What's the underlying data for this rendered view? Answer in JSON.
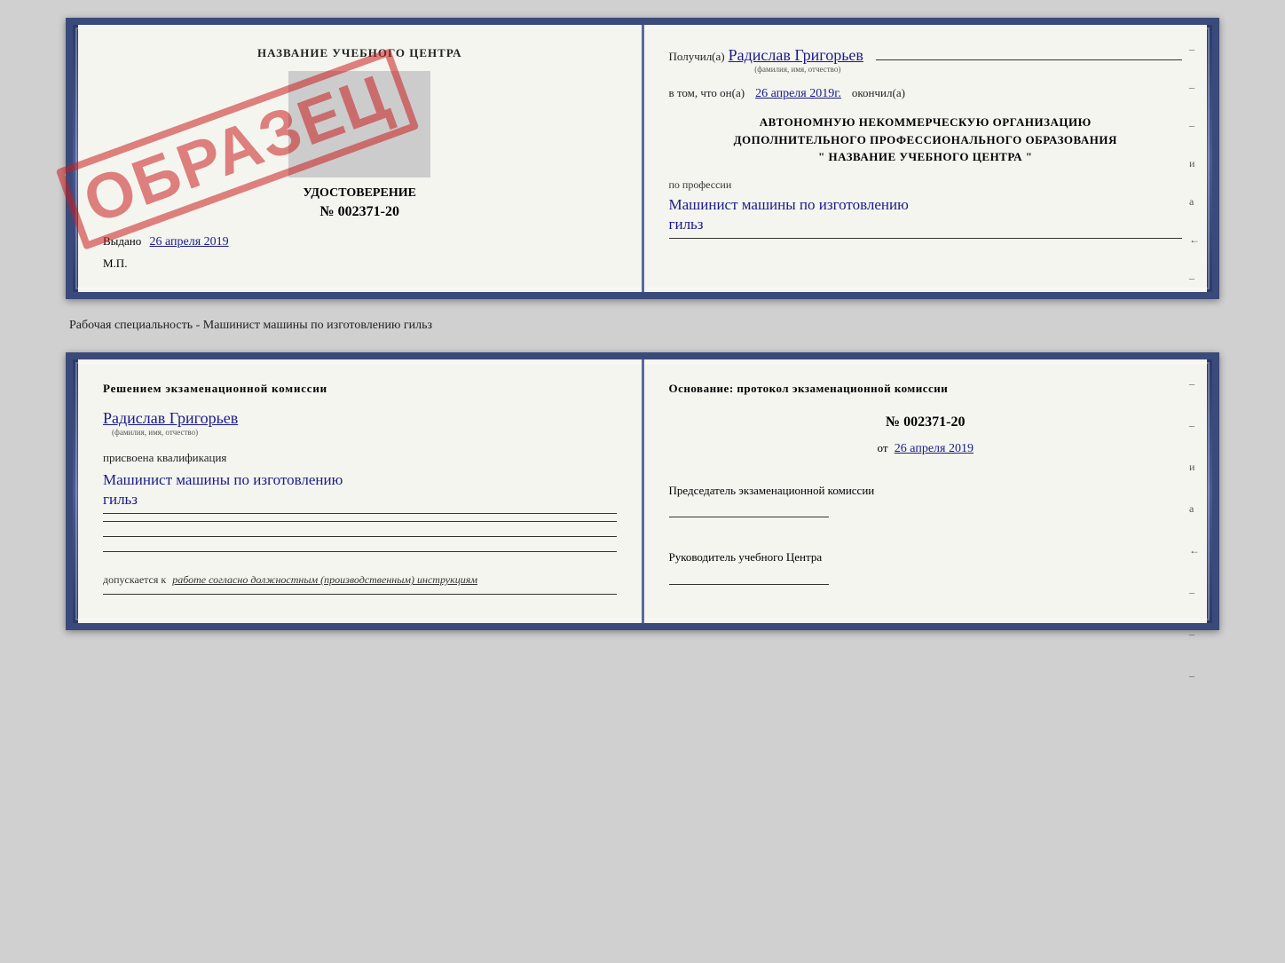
{
  "top_doc": {
    "left": {
      "training_center": "НАЗВАНИЕ УЧЕБНОГО ЦЕНТРА",
      "cert_label": "УДОСТОВЕРЕНИЕ",
      "cert_number": "№ 002371-20",
      "vydano_prefix": "Выдано",
      "vydano_date": "26 апреля 2019",
      "mp": "М.П.",
      "stamp": "ОБРАЗЕЦ"
    },
    "right": {
      "received_prefix": "Получил(а)",
      "received_name": "Радислав Григорьев",
      "fio_label": "(фамилия, имя, отчество)",
      "date_prefix": "в том, что он(а)",
      "date_value": "26 апреля 2019г.",
      "okончил": "окончил(а)",
      "org_line1": "АВТОНОМНУЮ НЕКОММЕРЧЕСКУЮ ОРГАНИЗАЦИЮ",
      "org_line2": "ДОПОЛНИТЕЛЬНОГО ПРОФЕССИОНАЛЬНОГО ОБРАЗОВАНИЯ",
      "org_name": "\"  НАЗВАНИЕ УЧЕБНОГО ЦЕНТРА  \"",
      "profession_label": "по профессии",
      "profession_value": "Машинист машины по изготовлению",
      "profession_value2": "гильз"
    }
  },
  "separator": {
    "text": "Рабочая специальность - Машинист машины по изготовлению гильз"
  },
  "bottom_doc": {
    "left": {
      "resolution_text": "Решением  экзаменационной  комиссии",
      "person_name": "Радислав Григорьев",
      "fio_label": "(фамилия, имя, отчество)",
      "qualification_label": "присвоена квалификация",
      "qualification_value": "Машинист машины по изготовлению",
      "qualification_value2": "гильз",
      "допускается_prefix": "допускается к",
      "допускается_value": "работе согласно должностным (производственным) инструкциям"
    },
    "right": {
      "osnov_text": "Основание:  протокол  экзаменационной  комиссии",
      "protocol_number": "№  002371-20",
      "ot_prefix": "от",
      "ot_date": "26 апреля 2019",
      "chairman_label": "Председатель экзаменационной комиссии",
      "head_label": "Руководитель учебного Центра"
    }
  },
  "side_marks": {
    "marks": [
      "–",
      "и",
      "а",
      "←",
      "–"
    ]
  }
}
